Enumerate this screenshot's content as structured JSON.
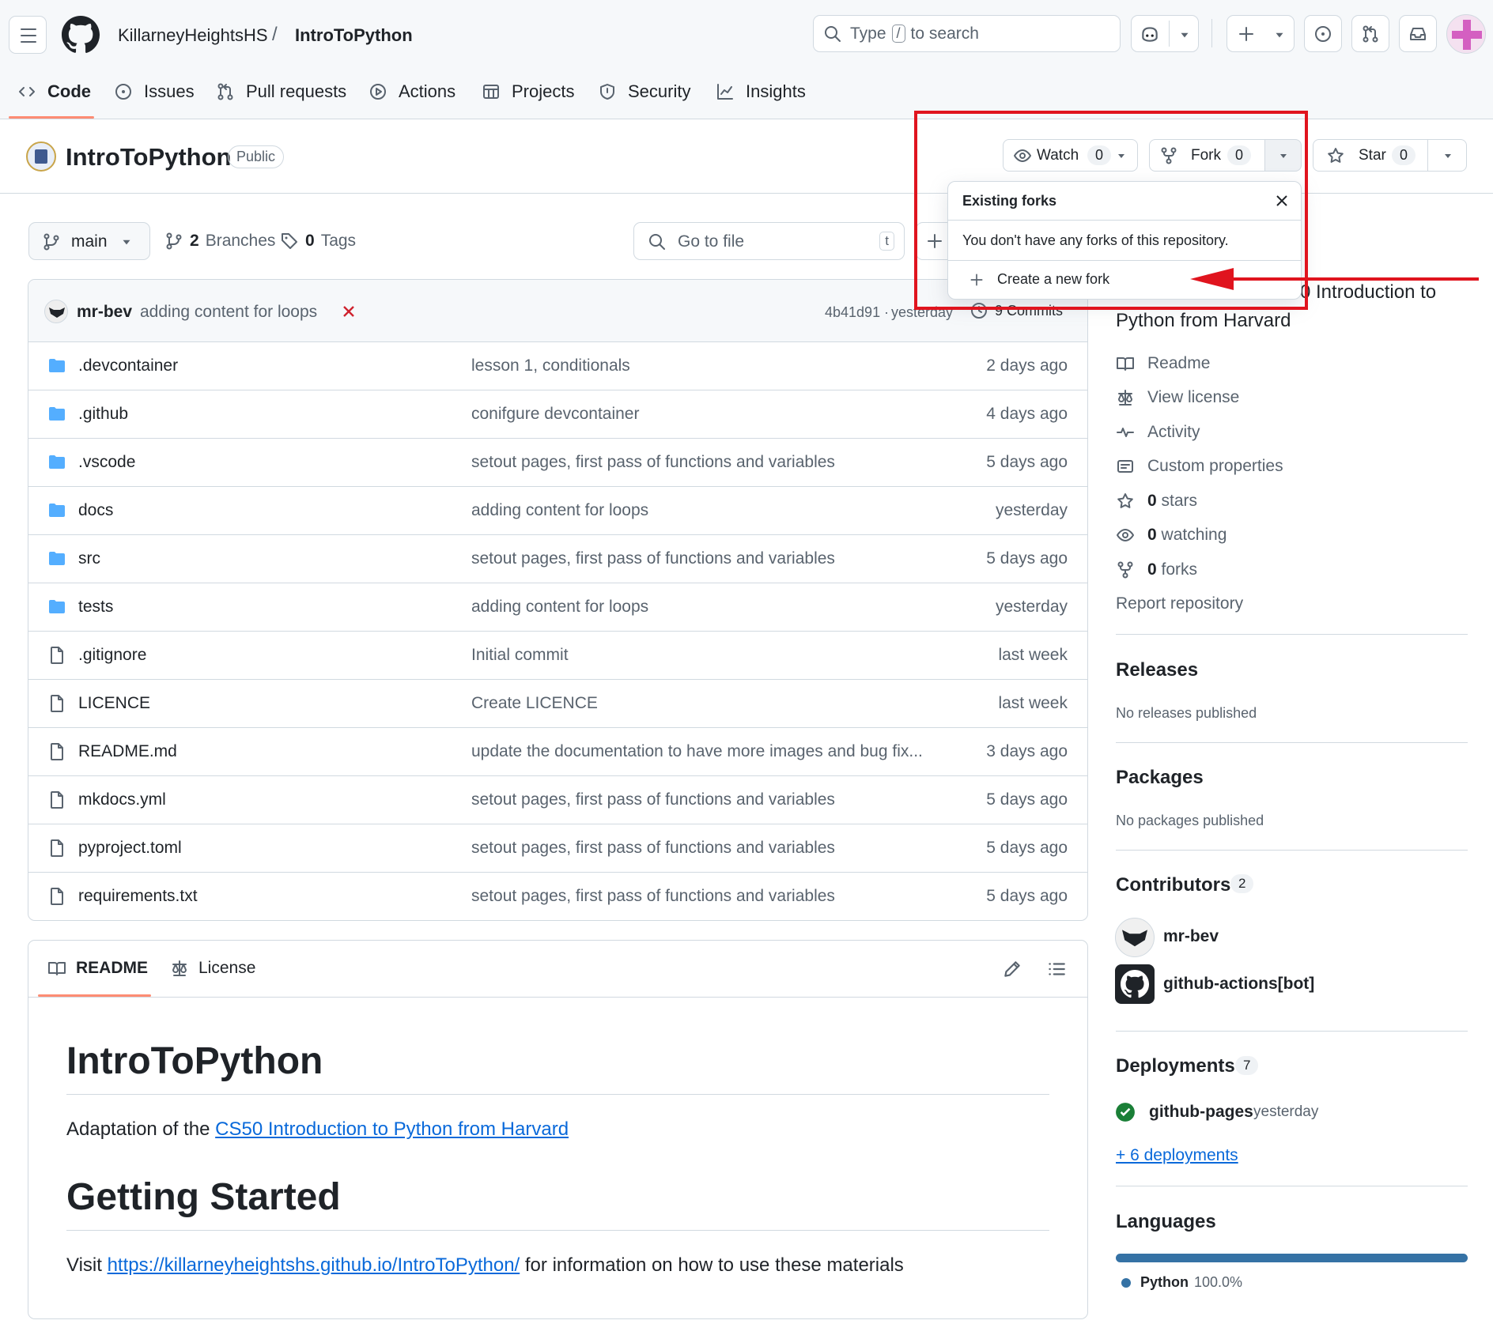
{
  "header": {
    "owner": "KillarneyHeightsHS",
    "separator": "/",
    "repo": "IntroToPython",
    "search_prefix": "Type",
    "search_key": "/",
    "search_suffix": "to search"
  },
  "tabs": [
    {
      "label": "Code"
    },
    {
      "label": "Issues"
    },
    {
      "label": "Pull requests"
    },
    {
      "label": "Actions"
    },
    {
      "label": "Projects"
    },
    {
      "label": "Security"
    },
    {
      "label": "Insights"
    }
  ],
  "repo": {
    "name": "IntroToPython",
    "visibility": "Public",
    "watch": {
      "label": "Watch",
      "count": "0"
    },
    "fork": {
      "label": "Fork",
      "count": "0"
    },
    "star": {
      "label": "Star",
      "count": "0"
    }
  },
  "fork_popup": {
    "title": "Existing forks",
    "message": "You don't have any forks of this repository.",
    "create": "Create a new fork"
  },
  "branch": {
    "name": "main",
    "branches_count": "2",
    "branches_label": "Branches",
    "tags_count": "0",
    "tags_label": "Tags",
    "go_to_file": "Go to file",
    "shortcut": "t"
  },
  "commit": {
    "author": "mr-bev",
    "message": "adding content for loops",
    "hash": "4b41d91",
    "sep": "·",
    "time": "yesterday",
    "commits": "9 Commits"
  },
  "files": [
    {
      "name": ".devcontainer",
      "type": "dir",
      "msg": "lesson 1, conditionals",
      "date": "2 days ago"
    },
    {
      "name": ".github",
      "type": "dir",
      "msg": "conifgure devcontainer",
      "date": "4 days ago"
    },
    {
      "name": ".vscode",
      "type": "dir",
      "msg": "setout pages, first pass of functions and variables",
      "date": "5 days ago"
    },
    {
      "name": "docs",
      "type": "dir",
      "msg": "adding content for loops",
      "date": "yesterday"
    },
    {
      "name": "src",
      "type": "dir",
      "msg": "setout pages, first pass of functions and variables",
      "date": "5 days ago"
    },
    {
      "name": "tests",
      "type": "dir",
      "msg": "adding content for loops",
      "date": "yesterday"
    },
    {
      "name": ".gitignore",
      "type": "file",
      "msg": "Initial commit",
      "date": "last week"
    },
    {
      "name": "LICENCE",
      "type": "file",
      "msg": "Create LICENCE",
      "date": "last week"
    },
    {
      "name": "README.md",
      "type": "file",
      "msg": "update the documentation to have more images and bug fix...",
      "date": "3 days ago"
    },
    {
      "name": "mkdocs.yml",
      "type": "file",
      "msg": "setout pages, first pass of functions and variables",
      "date": "5 days ago"
    },
    {
      "name": "pyproject.toml",
      "type": "file",
      "msg": "setout pages, first pass of functions and variables",
      "date": "5 days ago"
    },
    {
      "name": "requirements.txt",
      "type": "file",
      "msg": "setout pages, first pass of functions and variables",
      "date": "5 days ago"
    }
  ],
  "readme": {
    "tab_readme": "README",
    "tab_license": "License",
    "h1": "IntroToPython",
    "p1_prefix": "Adaptation of the",
    "p1_link": "CS50 Introduction to Python from Harvard",
    "h2": "Getting Started",
    "p2_prefix": "Visit",
    "p2_link": "https://killarneyheightshs.github.io/IntroToPython/",
    "p2_suffix": "for information on how to use these materials"
  },
  "about": {
    "desc_line1": "0 Introduction to",
    "desc_line2": "Python from Harvard",
    "items": [
      {
        "label": "Readme"
      },
      {
        "label": "View license"
      },
      {
        "label": "Activity"
      },
      {
        "label": "Custom properties"
      }
    ],
    "stars_n": "0",
    "stars": "stars",
    "watching_n": "0",
    "watching": "watching",
    "forks_n": "0",
    "forks": "forks",
    "report": "Report repository"
  },
  "releases": {
    "title": "Releases",
    "text": "No releases published"
  },
  "packages": {
    "title": "Packages",
    "text": "No packages published"
  },
  "contributors": {
    "title": "Contributors",
    "count": "2",
    "list": [
      {
        "name": "mr-bev"
      },
      {
        "name": "github-actions[bot]"
      }
    ]
  },
  "deployments": {
    "title": "Deployments",
    "count": "7",
    "env": "github-pages",
    "time": "yesterday",
    "more": "+ 6 deployments"
  },
  "languages": {
    "title": "Languages",
    "items": [
      {
        "name": "Python",
        "percent": "100.0%",
        "color": "#3572A5"
      }
    ]
  },
  "colors": {
    "annotation": "#e0141e",
    "link": "#0969da",
    "folder": "#54aeff",
    "accent": "#fd8c73"
  }
}
